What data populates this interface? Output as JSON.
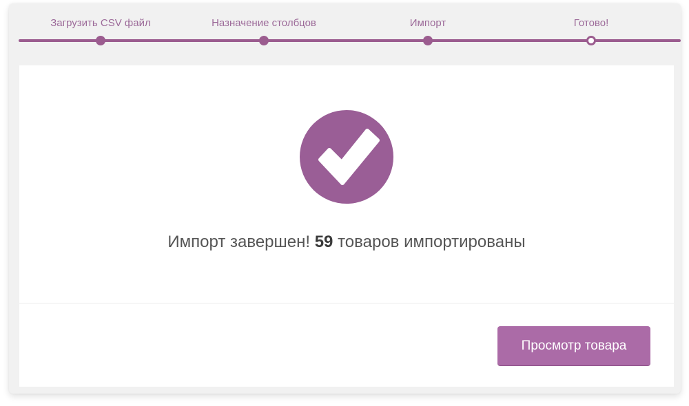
{
  "steps": [
    {
      "label": "Загрузить CSV файл",
      "status": "done"
    },
    {
      "label": "Назначение столбцов",
      "status": "done"
    },
    {
      "label": "Импорт",
      "status": "done"
    },
    {
      "label": "Готово!",
      "status": "current"
    }
  ],
  "result": {
    "prefix": "Импорт завершен!",
    "count": "59",
    "suffix": "товаров импортированы"
  },
  "actions": {
    "view_products_label": "Просмотр товара"
  },
  "icons": {
    "success": "checkmark-icon"
  },
  "colors": {
    "accent": "#9b5c8f",
    "button": "#ab6ba7",
    "step_text": "#9c6a99",
    "background": "#f1f1f1"
  }
}
